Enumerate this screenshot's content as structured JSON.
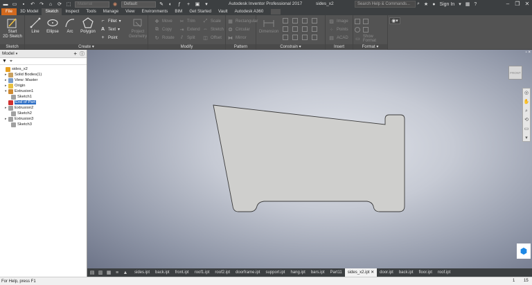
{
  "titlebar": {
    "app_title": "Autodesk Inventor Professional 2017",
    "file_name": "sides_x2",
    "material_value": "Material",
    "appearance_value": "Default",
    "search_placeholder": "Search Help & Commands...",
    "signin_label": "Sign In",
    "help_label": "?"
  },
  "tabs": [
    "File",
    "3D Model",
    "Sketch",
    "Inspect",
    "Tools",
    "Manage",
    "View",
    "Environments",
    "BIM",
    "Get Started",
    "Vault",
    "Autodesk A360"
  ],
  "active_tab": "Sketch",
  "ribbon": {
    "sketch_panel": {
      "label": "Sketch",
      "start_label_1": "Start",
      "start_label_2": "2D Sketch"
    },
    "create_panel": {
      "label": "Create",
      "line": "Line",
      "ellipse": "Ellipse",
      "arc": "Arc",
      "polygon": "Polygon",
      "fillet": "Fillet",
      "text": "Text",
      "point": "Point"
    },
    "project_geometry": {
      "label_1": "Project",
      "label_2": "Geometry"
    },
    "modify_panel": {
      "label": "Modify",
      "move": "Move",
      "copy": "Copy",
      "rotate": "Rotate",
      "trim": "Trim",
      "extend": "Extend",
      "split": "Split",
      "scale": "Scale",
      "stretch": "Stretch",
      "offset": "Offset"
    },
    "pattern_panel": {
      "label": "Pattern",
      "rectangular": "Rectangular",
      "circular": "Circular",
      "mirror": "Mirror"
    },
    "constrain_panel": {
      "label": "Constrain",
      "dimension": "Dimension"
    },
    "insert_panel": {
      "label": "Insert",
      "image": "Image",
      "points": "Points",
      "acad": "ACAD"
    },
    "format_panel": {
      "label": "Format",
      "show_format": "Show Format"
    }
  },
  "browser": {
    "title": "Model",
    "tree": [
      {
        "label": "sides_x2",
        "indent": 0,
        "twisty": "",
        "icon_color": "#e8a020"
      },
      {
        "label": "Solid Bodies(1)",
        "indent": 1,
        "twisty": "▸",
        "icon_color": "#c8a060"
      },
      {
        "label": "View: Master",
        "indent": 1,
        "twisty": "▸",
        "icon_color": "#7a9cc8"
      },
      {
        "label": "Origin",
        "indent": 1,
        "twisty": "▸",
        "icon_color": "#e8c040"
      },
      {
        "label": "Extrusion1",
        "indent": 1,
        "twisty": "▾",
        "icon_color": "#d08a30"
      },
      {
        "label": "Sketch1",
        "indent": 2,
        "twisty": "",
        "icon_color": "#a0a0a0"
      },
      {
        "label": "End of Part",
        "indent": 1,
        "twisty": "",
        "icon_color": "#d03030",
        "selected": true
      },
      {
        "label": "Extrusion2",
        "indent": 1,
        "twisty": "▸",
        "icon_color": "#a0a0a0"
      },
      {
        "label": "Sketch2",
        "indent": 2,
        "twisty": "",
        "icon_color": "#a0a0a0"
      },
      {
        "label": "Extrusion3",
        "indent": 1,
        "twisty": "▸",
        "icon_color": "#a0a0a0"
      },
      {
        "label": "Sketch3",
        "indent": 2,
        "twisty": "",
        "icon_color": "#a0a0a0"
      }
    ]
  },
  "viewcube_label": "FRONT",
  "doc_tabs": [
    "sides.ipt",
    "back.ipt",
    "front.ipt",
    "roof1.ipt",
    "roof2.ipt",
    "doorframe.ipt",
    "support.ipt",
    "hang.ipt",
    "bars.ipt",
    "Part11",
    "sides_x2.ipt",
    "door.ipt",
    "back.ipt",
    "floor.ipt",
    "roof.ipt"
  ],
  "active_doc": "sides_x2.ipt",
  "status": {
    "message": "For Help, press F1",
    "count_a": "1",
    "count_b": "15"
  }
}
